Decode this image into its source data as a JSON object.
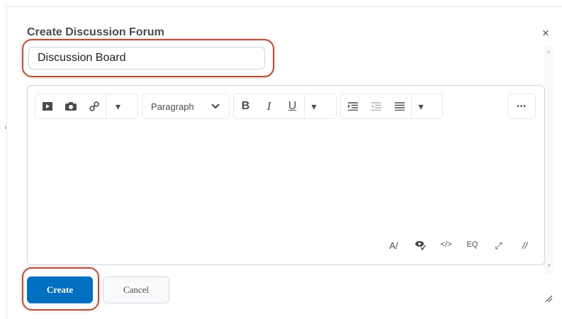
{
  "dialog": {
    "title": "Create Discussion Forum",
    "close_glyph": "×"
  },
  "name_field": {
    "value": "Discussion Board"
  },
  "toolbar": {
    "insert_stuff_icon": "video-icon",
    "insert_image_icon": "camera-icon",
    "insert_link_icon": "link-icon",
    "format_value": "Paragraph",
    "bold": "B",
    "italic": "I",
    "underline": "U",
    "more_label": "•••"
  },
  "editor_bottom_tools": [
    "A/",
    "👁",
    "</>",
    "EQ",
    "⤢",
    "//"
  ],
  "buttons": {
    "create": "Create",
    "cancel": "Cancel"
  },
  "colors": {
    "primary": "#006fbf",
    "annotation": "#b5503b",
    "border": "#cdd5dc"
  }
}
